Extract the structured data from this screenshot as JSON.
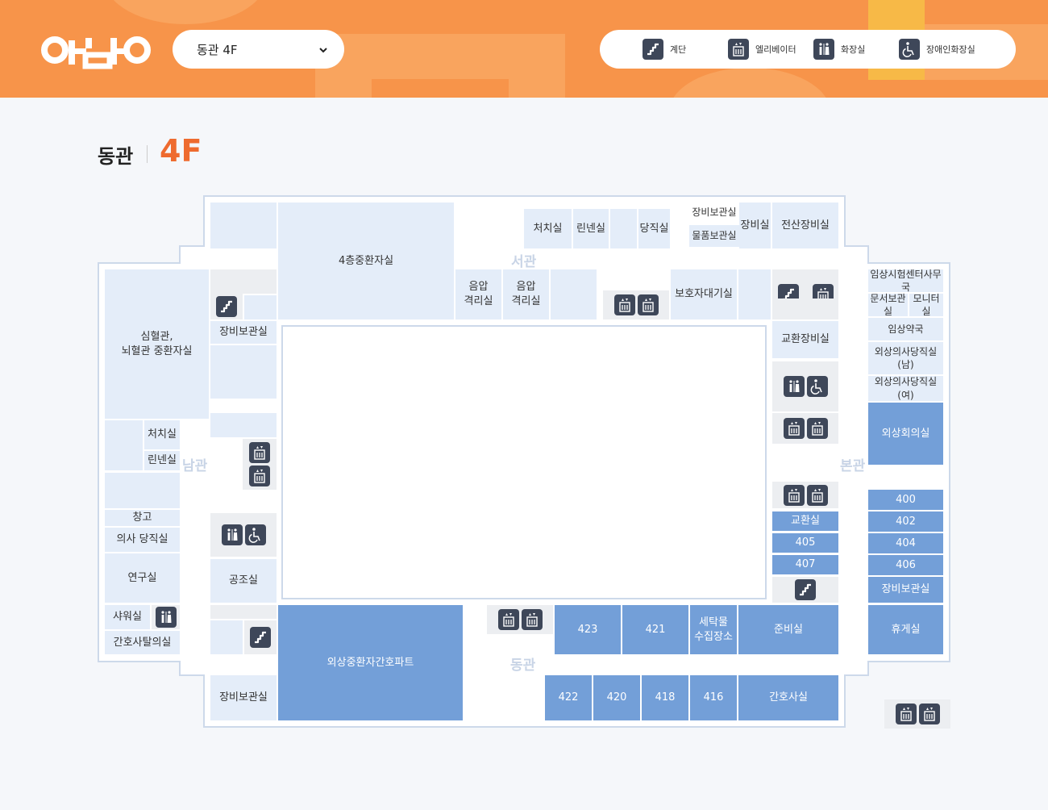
{
  "header": {
    "logo_text": "아주대",
    "floor_select": "동관 4F"
  },
  "legend": [
    {
      "icon": "stairs-icon",
      "label": "계단"
    },
    {
      "icon": "elevator-icon",
      "label": "엘리베이터"
    },
    {
      "icon": "restroom-icon",
      "label": "화장실"
    },
    {
      "icon": "accessible-icon",
      "label": "장애인화장실"
    }
  ],
  "title": {
    "building": "동관",
    "floor": "4F"
  },
  "wing_labels": {
    "west": "서관",
    "south": "남관",
    "main": "본관",
    "east": "동관"
  },
  "rooms": {
    "icu_4f": "4층중환자실",
    "treatment_top": "처치실",
    "linen_top": "린넨실",
    "duty_top": "당직실",
    "equip_storage_top": "장비보관실",
    "goods_storage": "물품보관실",
    "equip_room": "장비실",
    "computer_equip": "전산장비실",
    "neg_pressure_1": "음압\n격리실",
    "neg_pressure_2": "음압\n격리실",
    "guardian_wait": "보호자대기실",
    "clinical_trial": "임상시험센터사무국",
    "doc_storage": "문서보관실",
    "monitor_room": "모니터실",
    "clinical_pharmacy": "임상약국",
    "trauma_duty_m": "외상의사당직실(남)",
    "trauma_duty_f": "외상의사당직실(여)",
    "trauma_meeting": "외상회의실",
    "cardio_icu": "심혈관,\n뇌혈관 중환자실",
    "equip_storage_left": "장비보관실",
    "exchange_equip": "교환장비실",
    "treatment_left": "처치실",
    "linen_left": "린넨실",
    "warehouse": "창고",
    "doctor_duty": "의사 당직실",
    "research": "연구실",
    "shower": "샤워실",
    "nurse_locker": "간호사탈의실",
    "hvac": "공조실",
    "equip_storage_bottom": "장비보관실",
    "trauma_icu_nurse": "외상중환자간호파트",
    "exchange": "교환실",
    "r400": "400",
    "r402": "402",
    "r404": "404",
    "r406": "406",
    "r405": "405",
    "r407": "407",
    "equip_storage_right": "장비보관실",
    "r423": "423",
    "r421": "421",
    "laundry": "세탁물\n수집장소",
    "prep": "준비실",
    "lounge": "휴게실",
    "r422": "422",
    "r420": "420",
    "r418": "418",
    "r416": "416",
    "nurse_room": "간호사실"
  },
  "colors": {
    "header": "#f7944a",
    "accent": "#ee6b2f",
    "room_light": "#e4edf9",
    "room_dark": "#739fd8",
    "icon_bg": "#3e4759"
  }
}
